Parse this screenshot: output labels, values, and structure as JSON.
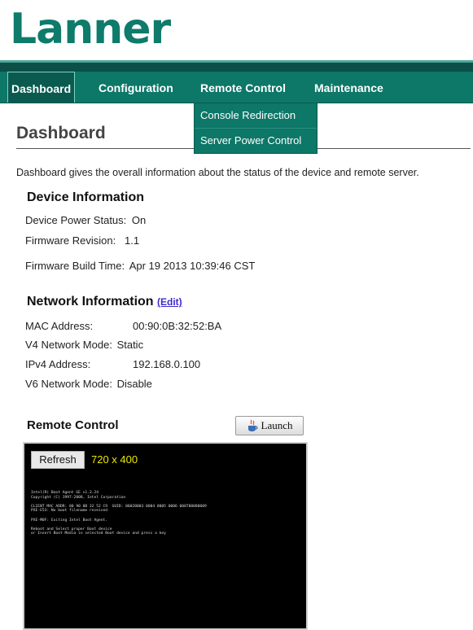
{
  "brand": {
    "logo_text": "Lanner"
  },
  "nav": {
    "items": [
      {
        "label": "Dashboard",
        "active": true
      },
      {
        "label": "Configuration",
        "active": false
      },
      {
        "label": "Remote Control",
        "active": false
      },
      {
        "label": "Maintenance",
        "active": false
      }
    ],
    "dropdown": [
      "Console Redirection",
      "Server Power Control"
    ]
  },
  "page": {
    "title": "Dashboard",
    "description": "Dashboard gives the overall information about the status of the device and remote server."
  },
  "device_info": {
    "heading": "Device Information",
    "power_label": "Device Power Status:",
    "power_value": "On",
    "fw_label": "Firmware Revision:",
    "fw_value": "1.1",
    "build_label": "Firmware Build Time:",
    "build_value": "Apr 19 2013 10:39:46 CST"
  },
  "network_info": {
    "heading": "Network Information",
    "edit_label": "(Edit)",
    "mac_label": "MAC Address:",
    "mac_value": "00:90:0B:32:52:BA",
    "v4_mode_label": "V4 Network Mode:",
    "v4_mode_value": "Static",
    "ipv4_label": "IPv4 Address:",
    "ipv4_value": "192.168.0.100",
    "v6_mode_label": "V6 Network Mode:",
    "v6_mode_value": "Disable"
  },
  "remote_control": {
    "heading": "Remote Control",
    "launch_label": "Launch",
    "refresh_label": "Refresh",
    "resolution": "720 x 400",
    "console_text": "Intel(R) Boot Agent GE v1.3.24\nCopyright (C) 1997-2008, Intel Corporation\n\nCLIENT MAC ADDR: 00 90 0B 32 52 C9  GUID: 00020003 0004 0005 0006 000700080009\nPXE-E53: No boot filename received\n\nPXE-M0F: Exiting Intel Boot Agent.\n\nReboot and Select proper Boot device\nor Insert Boot Media in selected Boot device and press a key"
  },
  "colors": {
    "nav_bg": "#0d7768",
    "nav_dark": "#0b4f48",
    "logo": "#0e7b6b",
    "resolution_text": "#e8e800",
    "edit_link": "#3b2bd0"
  },
  "icons": {
    "launch": "java-cup-icon"
  }
}
